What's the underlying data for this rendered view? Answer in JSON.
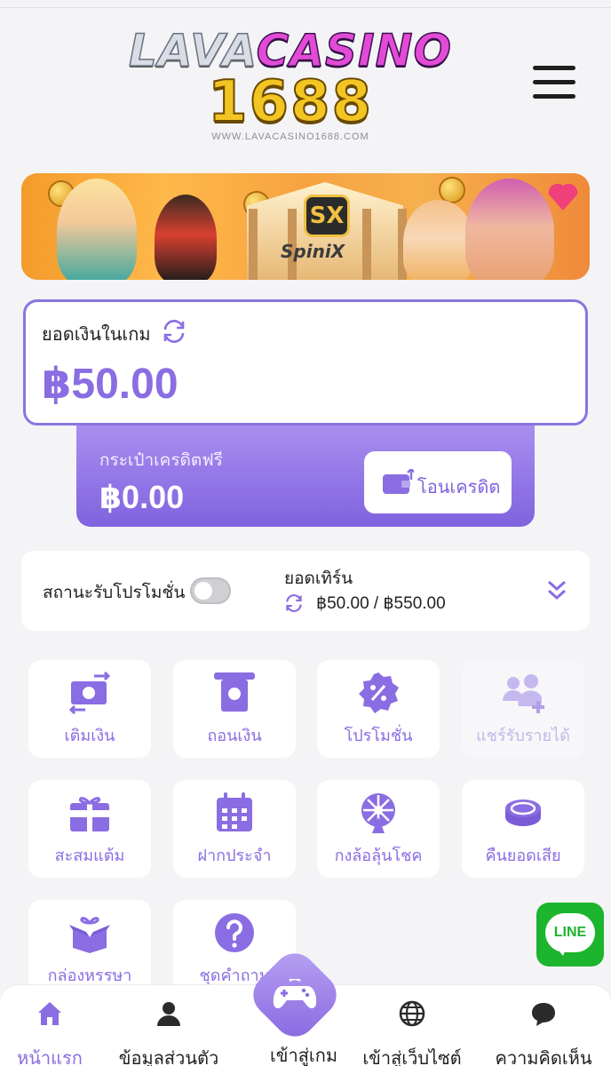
{
  "header": {
    "logo_top_a": "LAVA",
    "logo_top_b": "CASINO",
    "logo_number": "1688",
    "logo_url": "WWW.LAVACASINO1688.COM",
    "menu_icon": "hamburger-menu-icon"
  },
  "banner": {
    "brand": "SpiniX",
    "brand_badge": "SX"
  },
  "balance": {
    "label": "ยอดเงินในเกม",
    "amount": "฿50.00",
    "refresh_icon": "refresh-icon"
  },
  "free_credit": {
    "label": "กระเป๋าเครดิตฟรี",
    "amount": "฿0.00",
    "transfer_label": "โอนเครดิต"
  },
  "promo": {
    "status_label": "สถานะรับโปรโมชั่น",
    "toggle_on": false,
    "turnover_label": "ยอดเทิร์น",
    "turnover_value": "฿50.00 / ฿550.00"
  },
  "menu_grid": [
    {
      "label": "เติมเงิน",
      "icon": "deposit-icon",
      "enabled": true
    },
    {
      "label": "ถอนเงิน",
      "icon": "withdraw-icon",
      "enabled": true
    },
    {
      "label": "โปรโมชั่น",
      "icon": "promotion-icon",
      "enabled": true
    },
    {
      "label": "แชร์รับรายได้",
      "icon": "affiliate-icon",
      "enabled": false
    },
    {
      "label": "สะสมแต้ม",
      "icon": "gift-points-icon",
      "enabled": true
    },
    {
      "label": "ฝากประจำ",
      "icon": "calendar-icon",
      "enabled": true
    },
    {
      "label": "กงล้อลุ้นโชค",
      "icon": "wheel-icon",
      "enabled": true
    },
    {
      "label": "คืนยอดเสีย",
      "icon": "coin-cashback-icon",
      "enabled": true
    },
    {
      "label": "กล่องหรรษา",
      "icon": "mystery-box-icon",
      "enabled": true
    },
    {
      "label": "ชุดคำถาม",
      "icon": "question-icon",
      "enabled": true
    }
  ],
  "line_button": {
    "label": "LINE"
  },
  "bottom_nav": {
    "home": "หน้าแรก",
    "profile": "ข้อมูลส่วนตัว",
    "play": "เข้าสู่เกม",
    "website": "เข้าสู่เว็บไซต์",
    "feedback": "ความคิดเห็น"
  },
  "colors": {
    "accent": "#8a6de2",
    "accent_dark": "#7f63df",
    "line_green": "#1db42e"
  }
}
